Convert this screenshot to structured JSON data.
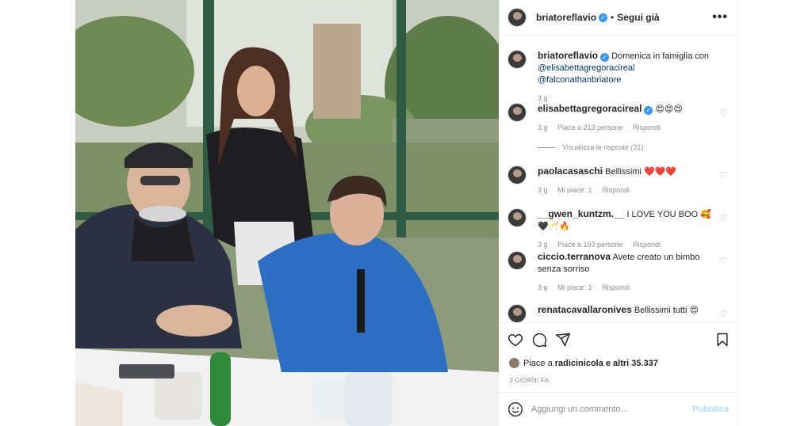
{
  "header": {
    "username": "briatoreflavio",
    "separator": "•",
    "follow_label": "Segui già",
    "more_label": "•••"
  },
  "caption": {
    "username": "briatoreflavio",
    "text": "Domenica in famiglia con",
    "mention1": "@elisabettagregoracireal",
    "mention2": "@falconathanbriatore",
    "time": "3 g"
  },
  "comments": [
    {
      "username": "elisabettagregoracireal",
      "verified": true,
      "text": "😍😍😍",
      "time": "3 g",
      "likes": "Piace a 213 persone",
      "reply": "Rispondi"
    },
    {
      "username": "paolacasaschi",
      "verified": false,
      "text": "Bellissimi ❤️❤️❤️",
      "time": "3 g",
      "likes": "Mi piace: 1",
      "reply": "Rispondi"
    },
    {
      "username": "__gwen_kuntzm.__",
      "verified": false,
      "text": "I LOVE YOU BOO 🥰🖤🥂🔥",
      "time": "3 g",
      "likes": "Piace a 193 persone",
      "reply": "Rispondi"
    },
    {
      "username": "ciccio.terranova",
      "verified": false,
      "text": "Avete creato un bimbo senza sorriso",
      "time": "3 g",
      "likes": "Mi piace: 1",
      "reply": "Rispondi"
    },
    {
      "username": "renatacavallaronives",
      "verified": false,
      "text": "Bellissimi tutti 😍",
      "time": "",
      "likes": "",
      "reply": ""
    }
  ],
  "view_replies": "Visualizza le risposte (31)",
  "likes_line": {
    "prefix": "Piace a ",
    "user": "radicinicola",
    "suffix": " e altri 35.337"
  },
  "post_age": "3 GIORNI FA",
  "add_comment": {
    "placeholder": "Aggiungi un commento...",
    "publish_label": "Pubblica"
  },
  "colors": {
    "verified": "#3897f0",
    "link": "#00376b",
    "muted": "#8e8e8e",
    "publish": "#b2dffc"
  },
  "icons": [
    "heart-icon",
    "comment-icon",
    "share-icon",
    "bookmark-icon",
    "smile-icon",
    "more-icon"
  ]
}
